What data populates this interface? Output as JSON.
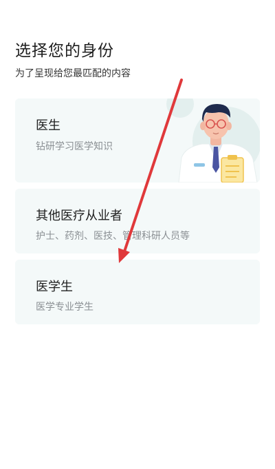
{
  "header": {
    "title": "选择您的身份",
    "subtitle": "为了呈现给您最匹配的内容"
  },
  "identities": [
    {
      "title": "医生",
      "description": "钻研学习医学知识",
      "illustration": "doctor-illustration"
    },
    {
      "title": "其他医疗从业者",
      "description": "护士、药剂、医技、管理科研人员等"
    },
    {
      "title": "医学生",
      "description": "医学专业学生"
    }
  ],
  "colors": {
    "card_background": "#f4f9f9",
    "title_text": "#1e1e1e",
    "description_text": "#8a8f93",
    "annotation_arrow": "#e0393b"
  }
}
